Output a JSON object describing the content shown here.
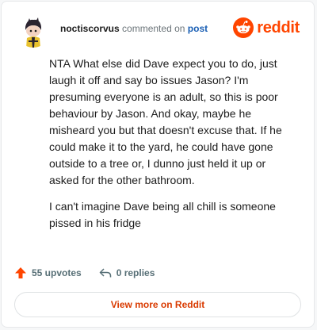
{
  "header": {
    "username": "noctiscorvus",
    "action_text": "commented on",
    "post_link": "post",
    "logo_text": "reddit"
  },
  "comment": {
    "paragraphs": [
      "NTA What else did Dave expect you to do, just laugh it off and say bo issues Jason? I'm presuming everyone is an adult, so this is poor behaviour by Jason. And okay, maybe he misheard you but that doesn't excuse that. If he could make it to the yard, he could have gone outside to a tree or, I dunno just held it up or asked for the other bathroom.",
      "I can't imagine Dave being all chill is someone pissed in his fridge"
    ]
  },
  "actions": {
    "upvotes": "55 upvotes",
    "replies": "0 replies"
  },
  "footer": {
    "view_more": "View more on Reddit"
  },
  "colors": {
    "brand": "#ff4500",
    "link": "#1a5fb4",
    "view_more_text": "#d93a00",
    "upvote_icon": "#ff4500"
  },
  "icons": {
    "avatar": "snoo-avatar",
    "logo": "reddit-snoo-icon",
    "upvote": "upvote-arrow-icon",
    "reply": "reply-arrow-icon"
  }
}
